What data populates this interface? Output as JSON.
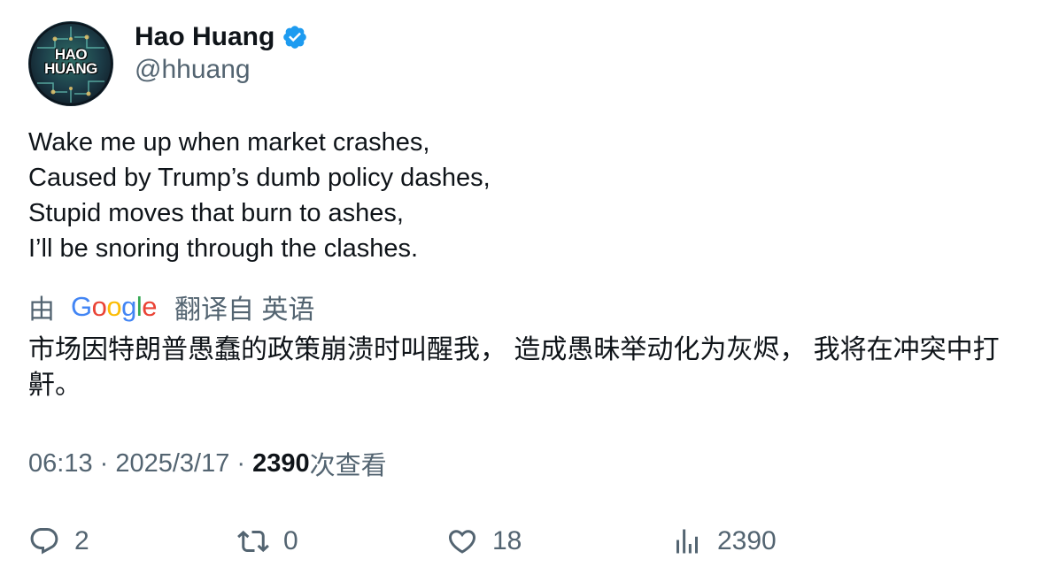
{
  "author": {
    "name": "Hao Huang",
    "handle": "@hhuang",
    "avatar_text_line1": "HAO",
    "avatar_text_line2": "HUANG",
    "verified_color": "#1d9bf0"
  },
  "tweet": {
    "lines": [
      "Wake me up when market crashes,",
      "Caused by Trump’s dumb policy dashes,",
      "Stupid moves that burn to ashes,",
      "I’ll be snoring through the clashes."
    ]
  },
  "translation": {
    "prefix": "由",
    "google_letters": [
      "G",
      "o",
      "o",
      "g",
      "l",
      "e"
    ],
    "google_colors": [
      "#4285f4",
      "#ea4335",
      "#fbbc05",
      "#4285f4",
      "#34a853",
      "#ea4335"
    ],
    "suffix": "翻译自 英语",
    "text": "市场因特朗普愚蠢的政策崩溃时叫醒我， 造成愚昧举动化为灰烬， 我将在冲突中打鼾。"
  },
  "meta": {
    "time": "06:13",
    "sep1": " · ",
    "date": "2025/3/17",
    "sep2": " · ",
    "views": "2390",
    "views_label": "次查看"
  },
  "actions": {
    "replies": "2",
    "reposts": "0",
    "likes": "18",
    "views": "2390",
    "icons": [
      "reply-icon",
      "repost-icon",
      "like-icon",
      "views-icon"
    ]
  }
}
